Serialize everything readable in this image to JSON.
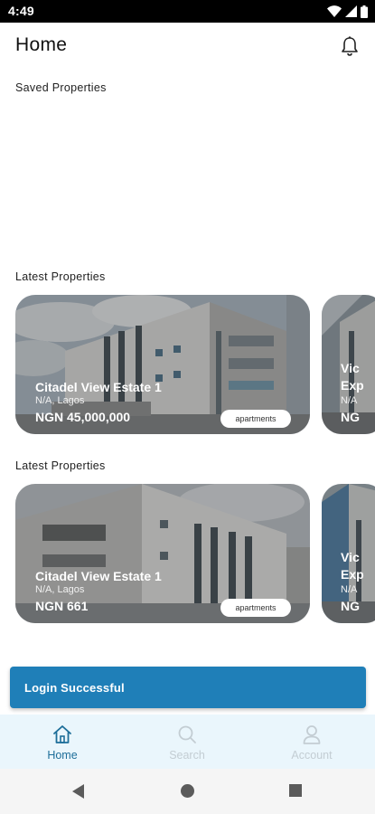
{
  "status_bar": {
    "time": "4:49"
  },
  "header": {
    "title": "Home"
  },
  "sections": {
    "saved_title": "Saved Properties",
    "latest_title_1": "Latest Properties",
    "latest_title_2": "Latest Properties"
  },
  "carousel_1": {
    "card": {
      "name": "Citadel View Estate 1",
      "location": "N/A, Lagos",
      "price": "NGN 45,000,000",
      "tag": "apartments"
    },
    "peek": {
      "name_line1": "Vic",
      "name_line2": "Exp",
      "location": "N/A",
      "price": "NG"
    }
  },
  "carousel_2": {
    "card": {
      "name": "Citadel View Estate 1",
      "location": "N/A, Lagos",
      "price": "NGN 661",
      "tag": "apartments"
    },
    "peek": {
      "name_line1": "Vic",
      "name_line2": "Exp",
      "location": "N/A",
      "price": "NG"
    }
  },
  "toast": {
    "message": "Login Successful"
  },
  "bottom_nav": {
    "items": [
      {
        "label": "Home",
        "icon": "home-icon",
        "active": true
      },
      {
        "label": "Search",
        "icon": "search-icon",
        "active": false
      },
      {
        "label": "Account",
        "icon": "account-icon",
        "active": false
      }
    ]
  },
  "colors": {
    "accent": "#1d6e99",
    "toast_bg": "#1f7fb8",
    "nav_bg": "#eaf6fc",
    "inactive": "#c3cdd3"
  }
}
